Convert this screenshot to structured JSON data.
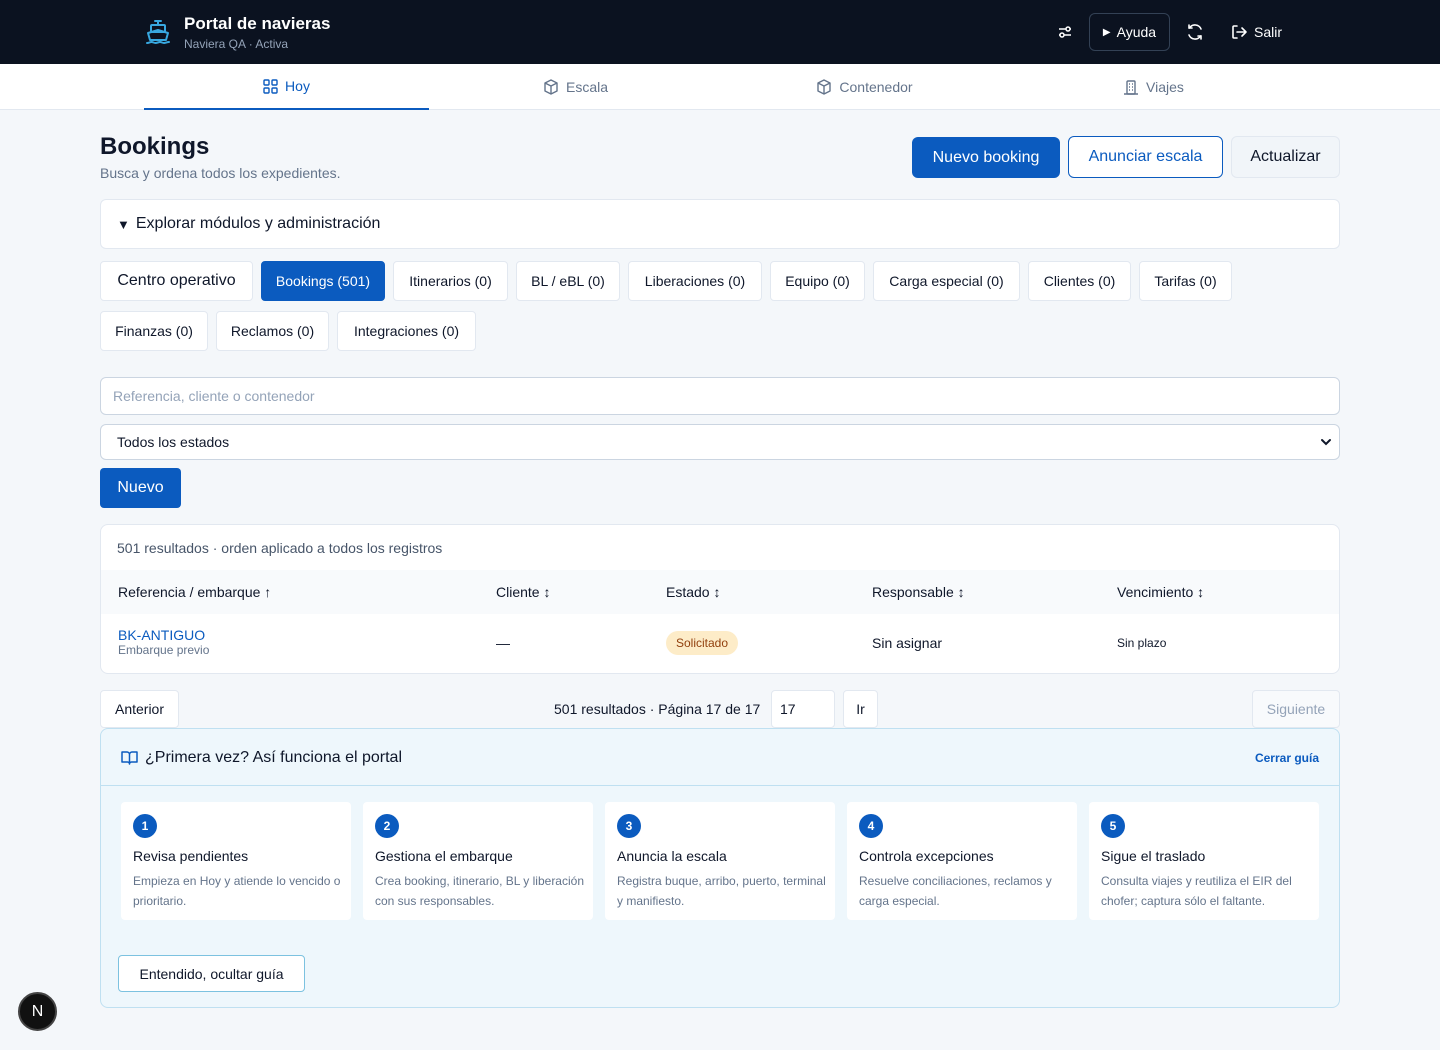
{
  "app": {
    "title": "Portal de navieras",
    "subtitle": "Naviera QA · Activa"
  },
  "topbar": {
    "help_label": "Ayuda",
    "logout_label": "Salir"
  },
  "tabs": [
    {
      "label": "Hoy",
      "icon": "grid-icon",
      "active": true
    },
    {
      "label": "Escala",
      "icon": "box-icon",
      "active": false
    },
    {
      "label": "Contenedor",
      "icon": "box-icon",
      "active": false
    },
    {
      "label": "Viajes",
      "icon": "building-icon",
      "active": false
    }
  ],
  "page": {
    "title": "Bookings",
    "subtitle": "Busca y ordena todos los expedientes."
  },
  "actions": {
    "new_booking": "Nuevo booking",
    "announce": "Anunciar escala",
    "refresh": "Actualizar"
  },
  "explore": {
    "label": "Explorar módulos y administración"
  },
  "modules": [
    "Centro operativo",
    "Bookings (501)",
    "Itinerarios (0)",
    "BL / eBL (0)",
    "Liberaciones (0)",
    "Equipo (0)",
    "Carga especial (0)",
    "Clientes (0)",
    "Tarifas (0)",
    "Finanzas (0)",
    "Reclamos (0)",
    "Integraciones (0)"
  ],
  "search": {
    "placeholder": "Referencia, cliente o contenedor"
  },
  "status_filter": {
    "selected": "Todos los estados"
  },
  "new_button": "Nuevo",
  "results": {
    "summary": "501 resultados · orden aplicado a todos los registros",
    "columns": [
      "Referencia / embarque ↑",
      "Cliente ↕",
      "Estado ↕",
      "Responsable ↕",
      "Vencimiento ↕"
    ],
    "rows": [
      {
        "ref": "BK-ANTIGUO",
        "ref_sub": "Embarque previo",
        "client": "—",
        "status": "Solicitado",
        "owner": "Sin asignar",
        "due": "Sin plazo"
      }
    ]
  },
  "pagination": {
    "prev": "Anterior",
    "info": "501 resultados · Página 17 de 17",
    "page_value": "17",
    "go": "Ir",
    "next": "Siguiente"
  },
  "guide": {
    "title": "¿Primera vez? Así funciona el portal",
    "close": "Cerrar guía",
    "steps": [
      {
        "num": "1",
        "title": "Revisa pendientes",
        "desc": "Empieza en Hoy y atiende lo vencido o prioritario."
      },
      {
        "num": "2",
        "title": "Gestiona el embarque",
        "desc": "Crea booking, itinerario, BL y liberación con sus responsables."
      },
      {
        "num": "3",
        "title": "Anuncia la escala",
        "desc": "Registra buque, arribo, puerto, terminal y manifiesto."
      },
      {
        "num": "4",
        "title": "Controla excepciones",
        "desc": "Resuelve conciliaciones, reclamos y carga especial."
      },
      {
        "num": "5",
        "title": "Sigue el traslado",
        "desc": "Consulta viajes y reutiliza el EIR del chofer; captura sólo el faltante."
      }
    ],
    "hide": "Entendido, ocultar guía"
  },
  "dev_badge": "N",
  "colors": {
    "primary": "#0b5bbf",
    "topbar": "#0b1220",
    "badge_bg": "#fdecc8"
  }
}
